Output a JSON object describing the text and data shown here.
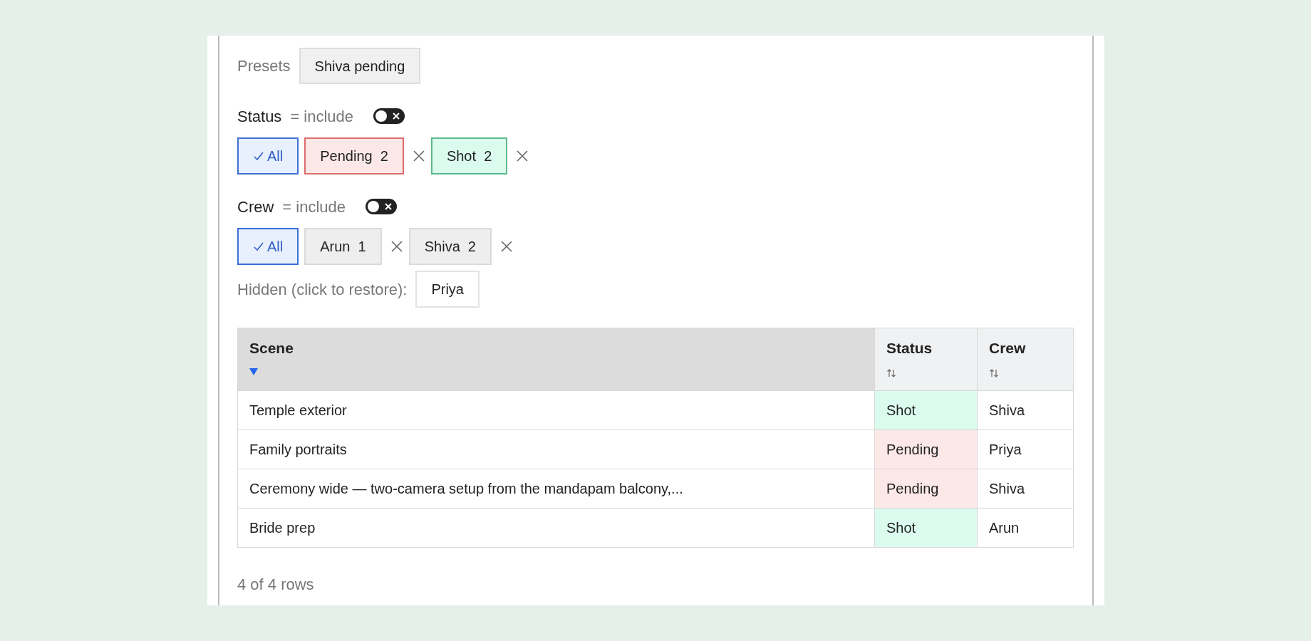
{
  "presets": {
    "label": "Presets",
    "items": [
      "Shiva pending"
    ]
  },
  "filters": [
    {
      "label": "Status",
      "mode": "= include",
      "toggle_on": false,
      "chips": [
        {
          "kind": "all",
          "label": "All",
          "selected": true
        },
        {
          "kind": "value",
          "label": "Pending",
          "count": "2",
          "color": "#fde8e8"
        },
        {
          "kind": "value",
          "label": "Shot",
          "count": "2",
          "color": "#dcfbef"
        }
      ]
    },
    {
      "label": "Crew",
      "mode": "= include",
      "toggle_on": false,
      "chips": [
        {
          "kind": "all",
          "label": "All",
          "selected": true
        },
        {
          "kind": "value",
          "label": "Arun",
          "count": "1",
          "color": "#eeeeee"
        },
        {
          "kind": "value",
          "label": "Shiva",
          "count": "2",
          "color": "#eeeeee"
        }
      ]
    }
  ],
  "hidden": {
    "label": "Hidden (click to restore):",
    "items": [
      "Priya"
    ]
  },
  "table": {
    "columns": [
      {
        "label": "Scene",
        "sorted": true
      },
      {
        "label": "Status",
        "sorted": false
      },
      {
        "label": "Crew",
        "sorted": false
      }
    ],
    "rows": [
      {
        "scene": "Temple exterior",
        "status": "Shot",
        "color": "#dcfbef",
        "crew": "Shiva"
      },
      {
        "scene": "Family portraits",
        "status": "Pending",
        "color": "#fde8e8",
        "crew": "Priya"
      },
      {
        "scene": "Ceremony wide — two-camera setup from the mandapam balcony,...",
        "status": "Pending",
        "color": "#fde8e8",
        "crew": "Shiva"
      },
      {
        "scene": "Bride prep",
        "status": "Shot",
        "color": "#dcfbef",
        "crew": "Arun"
      }
    ]
  },
  "footer": "4 of 4 rows"
}
